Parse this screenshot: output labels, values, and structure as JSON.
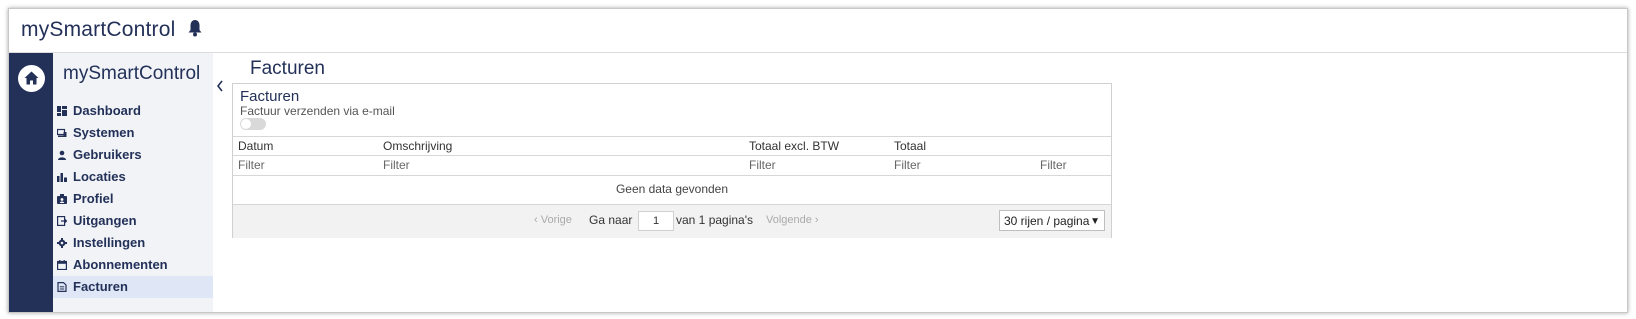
{
  "header": {
    "brand": "mySmartControl",
    "notification_icon": "bell-icon"
  },
  "rail": {
    "home_icon": "home-icon"
  },
  "sidebar": {
    "title": "mySmartControl",
    "items": [
      {
        "label": "Dashboard",
        "icon": "dashboard-icon"
      },
      {
        "label": "Systemen",
        "icon": "systems-icon"
      },
      {
        "label": "Gebruikers",
        "icon": "user-icon"
      },
      {
        "label": "Locaties",
        "icon": "locations-icon"
      },
      {
        "label": "Profiel",
        "icon": "profile-icon"
      },
      {
        "label": "Uitgangen",
        "icon": "outputs-icon"
      },
      {
        "label": "Instellingen",
        "icon": "gear-icon"
      },
      {
        "label": "Abonnementen",
        "icon": "calendar-icon"
      },
      {
        "label": "Facturen",
        "icon": "invoice-icon"
      }
    ],
    "active": "Facturen"
  },
  "main": {
    "page_title": "Facturen",
    "panel": {
      "title": "Facturen",
      "subtitle": "Factuur verzenden via e-mail",
      "toggle_on": false,
      "columns": [
        "Datum",
        "Omschrijving",
        "Totaal excl. BTW",
        "Totaal",
        ""
      ],
      "filter_placeholder": "Filter",
      "empty_text": "Geen data gevonden",
      "pager": {
        "prev": "‹ Vorige",
        "goto": "Ga naar",
        "page": "1",
        "of_pages": "van 1 pagina's",
        "next": "Volgende ›",
        "rows_per_page": "30 rijen / pagina"
      }
    }
  }
}
